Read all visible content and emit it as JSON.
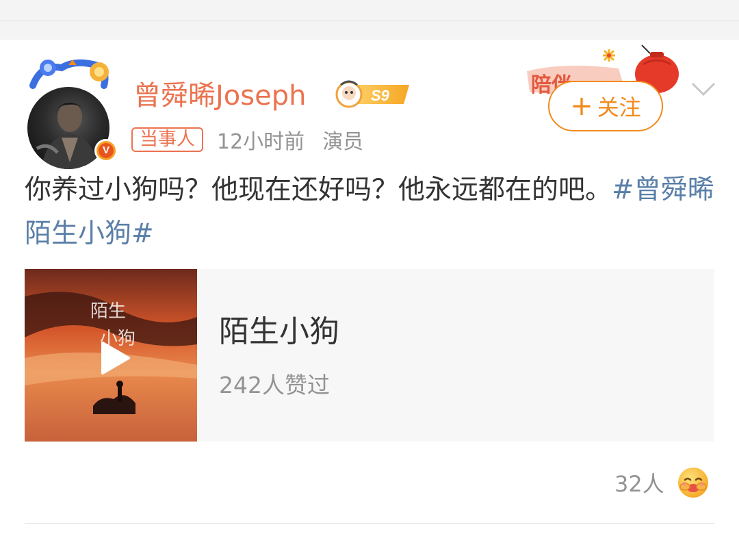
{
  "user": {
    "name": "曾舜晞Joseph",
    "level_badge": "S9",
    "tag": "当事人",
    "time": "12小时前",
    "role": "演员",
    "verified_badge": "V"
  },
  "follow": {
    "plus": "+",
    "label": "关注"
  },
  "post": {
    "text": "你养过小狗吗？他现在还好吗？他永远都在的吧。",
    "hashtag": "#曾舜晞陌生小狗#"
  },
  "media": {
    "title": "陌生小狗",
    "likes": "242人赞过",
    "cover_text": "陌生小狗"
  },
  "reactions": {
    "count": "32人",
    "emoji_icon": "hug-emoji-icon"
  },
  "colors": {
    "accent": "#eb7350",
    "follow": "#f28a1c",
    "hashtag": "#5a7fa8",
    "muted": "#939393"
  }
}
